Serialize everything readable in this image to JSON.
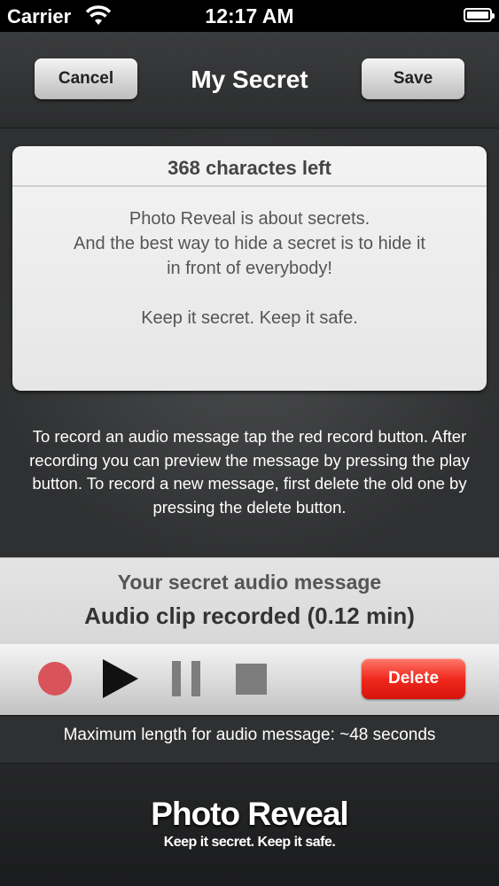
{
  "status_bar": {
    "carrier": "Carrier",
    "time": "12:17 AM"
  },
  "nav": {
    "title": "My Secret",
    "cancel_label": "Cancel",
    "save_label": "Save"
  },
  "card": {
    "chars_left": "368 charactes left",
    "lines": [
      "Photo Reveal is about secrets.",
      "And the best way to hide a secret is to hide it",
      "in front of everybody!",
      "",
      "Keep it secret. Keep it safe."
    ]
  },
  "instructions": "To record an audio message tap the red record button. After recording you can preview the message by pressing the play button. To record a new message, first delete the old one by pressing the delete button.",
  "audio": {
    "title": "Your secret audio message",
    "status": "Audio clip recorded (0.12 min)",
    "delete_label": "Delete",
    "max_length": "Maximum length for audio message: ~48 seconds"
  },
  "footer": {
    "brand": "Photo Reveal",
    "tagline": "Keep it secret. Keep it safe."
  },
  "colors": {
    "record": "#d9535b",
    "delete": "#f02a1e",
    "controls_gray": "#7d7d7d"
  }
}
